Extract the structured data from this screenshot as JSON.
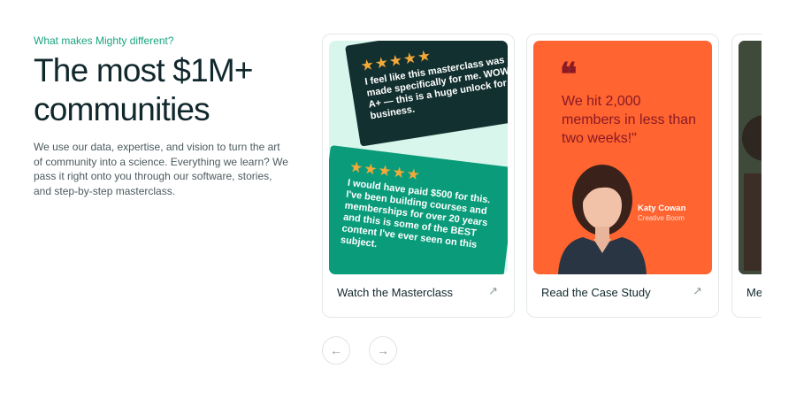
{
  "section": {
    "eyebrow": "What makes Mighty different?",
    "headline": "The most $1M+ communities",
    "lede": "We use our data, expertise, and vision to turn the art of community into a science. Everything we learn? We pass it right onto you through our software, stories, and step-by-step masterclass."
  },
  "cards": [
    {
      "label": "Watch the Masterclass",
      "arrow_icon": "arrow-up-right-icon",
      "testimonials": [
        {
          "stars": "★★★★★",
          "text": "I feel like this masterclass was made specifically for me. WOW. A+ — this is a huge unlock for my business."
        },
        {
          "stars": "★★★★★",
          "text": "I would have paid $500 for this. I've been building courses and memberships for over 20 years and this is some of the BEST content I've ever seen on this subject."
        }
      ]
    },
    {
      "label": "Read the Case Study",
      "arrow_icon": "arrow-up-right-icon",
      "quote_mark": "❝",
      "quote": "We hit 2,000 members in less than two weeks!\"",
      "person_name": "Katy Cowan",
      "person_role": "Creative Boom"
    },
    {
      "label": "Me"
    }
  ],
  "nav": {
    "prev_icon": "←",
    "next_icon": "→"
  },
  "colors": {
    "accent": "#1aa37e",
    "dark": "#12302f",
    "green": "#0a9c7a",
    "orange": "#ff6431",
    "star": "#f2a93a"
  }
}
